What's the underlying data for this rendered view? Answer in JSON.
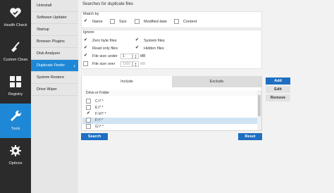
{
  "sidebar": {
    "items": [
      {
        "label": "Health Check",
        "icon": "health-check-icon"
      },
      {
        "label": "Custom Clean",
        "icon": "broom-icon"
      },
      {
        "label": "Registry",
        "icon": "registry-grid-icon"
      },
      {
        "label": "Tools",
        "icon": "wrench-icon"
      },
      {
        "label": "Options",
        "icon": "gear-icon"
      }
    ]
  },
  "submenu": {
    "items": [
      {
        "label": "Uninstall"
      },
      {
        "label": "Software Updater"
      },
      {
        "label": "Startup"
      },
      {
        "label": "Browser Plugins"
      },
      {
        "label": "Disk Analyzer"
      },
      {
        "label": "Duplicate Finder"
      },
      {
        "label": "System Restore"
      },
      {
        "label": "Drive Wiper"
      }
    ]
  },
  "main": {
    "title": "Searches for duplicate files",
    "match_by": {
      "label": "Match by",
      "options": [
        {
          "label": "Name",
          "checked": true
        },
        {
          "label": "Size",
          "checked": false
        },
        {
          "label": "Modified date",
          "checked": false
        },
        {
          "label": "Content",
          "checked": false
        }
      ]
    },
    "ignore": {
      "label": "Ignore",
      "options": [
        {
          "label": "Zero byte files",
          "checked": true
        },
        {
          "label": "System files",
          "checked": true
        },
        {
          "label": "Read only files",
          "checked": true
        },
        {
          "label": "Hidden files",
          "checked": true
        },
        {
          "label": "File size under",
          "checked": true,
          "value": "1",
          "unit": "MB"
        },
        {
          "label": "File size over",
          "checked": false,
          "value": "1000",
          "unit": "MB"
        }
      ]
    },
    "tabs": [
      {
        "label": "Include"
      },
      {
        "label": "Exclude"
      }
    ],
    "drives_header": "Drive or Folder",
    "drives": [
      {
        "path": "C:\\*.*",
        "checked": false
      },
      {
        "path": "E:\\*.*",
        "checked": false
      },
      {
        "path": "F:\\#\\*.*",
        "checked": true
      },
      {
        "path": "F:\\*.*",
        "checked": false
      },
      {
        "path": "G:\\*.*",
        "checked": false
      }
    ],
    "side_buttons": {
      "add": "Add",
      "edit": "Edit",
      "remove": "Remove"
    },
    "search_label": "Search",
    "reset_label": "Reset"
  },
  "colors": {
    "accent": "#1e88d6",
    "sidebar_bg": "#2b2b2b",
    "button": "#1e6fc2"
  }
}
